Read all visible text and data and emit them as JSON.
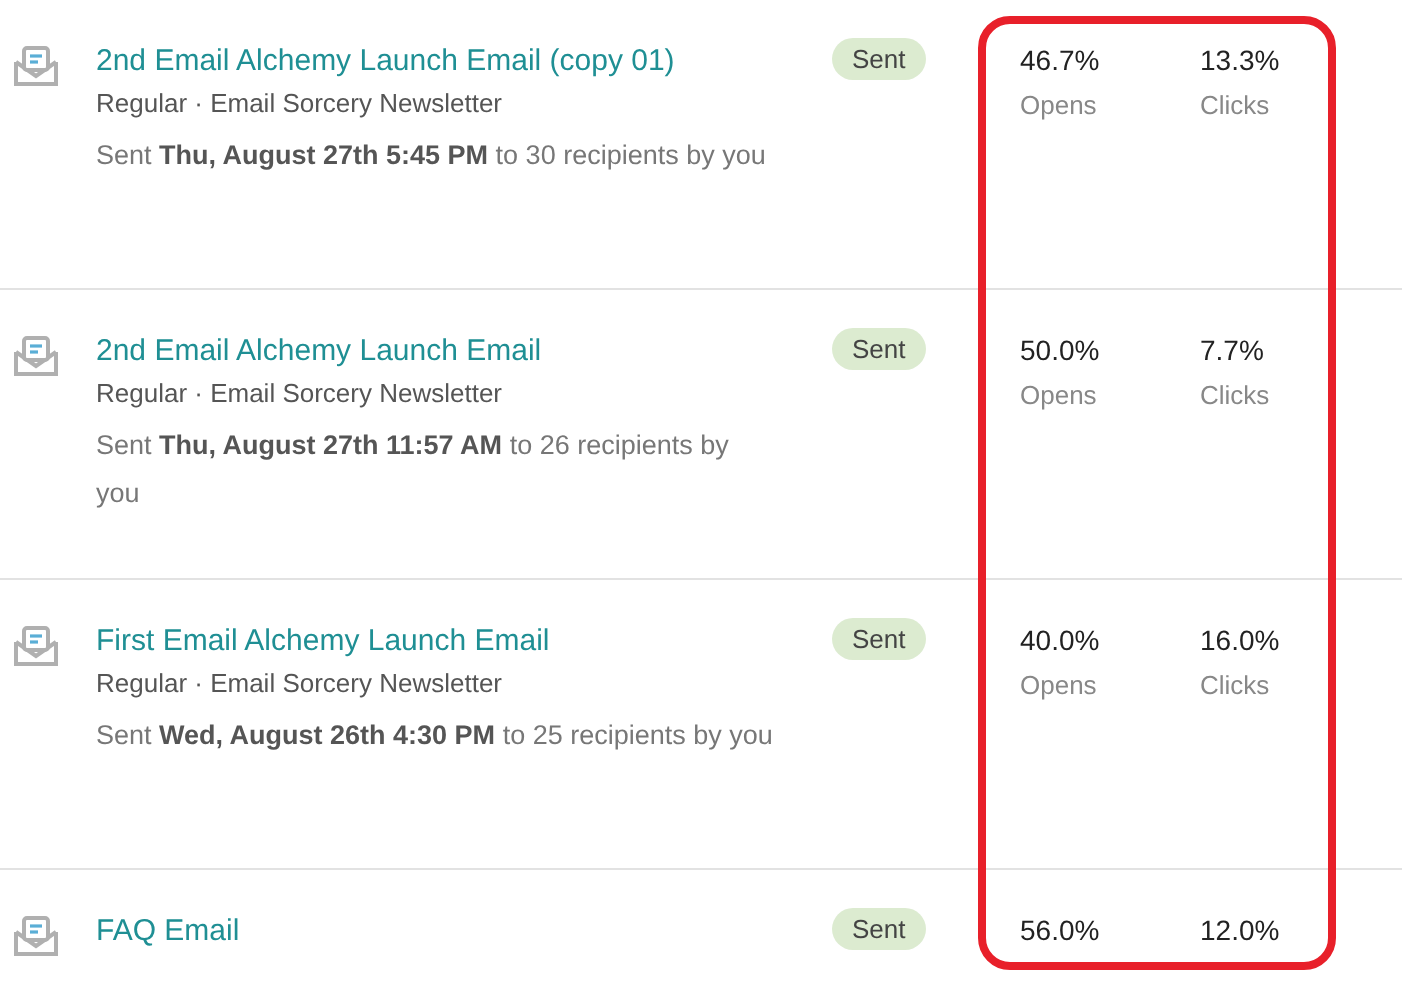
{
  "campaigns": [
    {
      "title": "2nd Email Alchemy Launch Email (copy 01)",
      "meta": "Regular · Email Sorcery Newsletter",
      "sent": "Sent **Thu, August 27th 5:45 PM** to 30 recipients by you",
      "status": "Sent",
      "opens": "46.7%",
      "opens_label": "Opens",
      "clicks": "13.3%",
      "clicks_label": "Clicks"
    },
    {
      "title": "2nd Email Alchemy Launch Email",
      "meta": "Regular · Email Sorcery Newsletter",
      "sent": "Sent **Thu, August 27th 11:57 AM** to 26 recipients by you",
      "status": "Sent",
      "opens": "50.0%",
      "opens_label": "Opens",
      "clicks": "7.7%",
      "clicks_label": "Clicks"
    },
    {
      "title": "First Email Alchemy Launch Email",
      "meta": "Regular · Email Sorcery Newsletter",
      "sent": "Sent **Wed, August 26th 4:30 PM** to 25 recipients by you",
      "status": "Sent",
      "opens": "40.0%",
      "opens_label": "Opens",
      "clicks": "16.0%",
      "clicks_label": "Clicks"
    },
    {
      "title": "FAQ Email",
      "status": "Sent",
      "opens": "56.0%",
      "clicks": "12.0%"
    }
  ]
}
